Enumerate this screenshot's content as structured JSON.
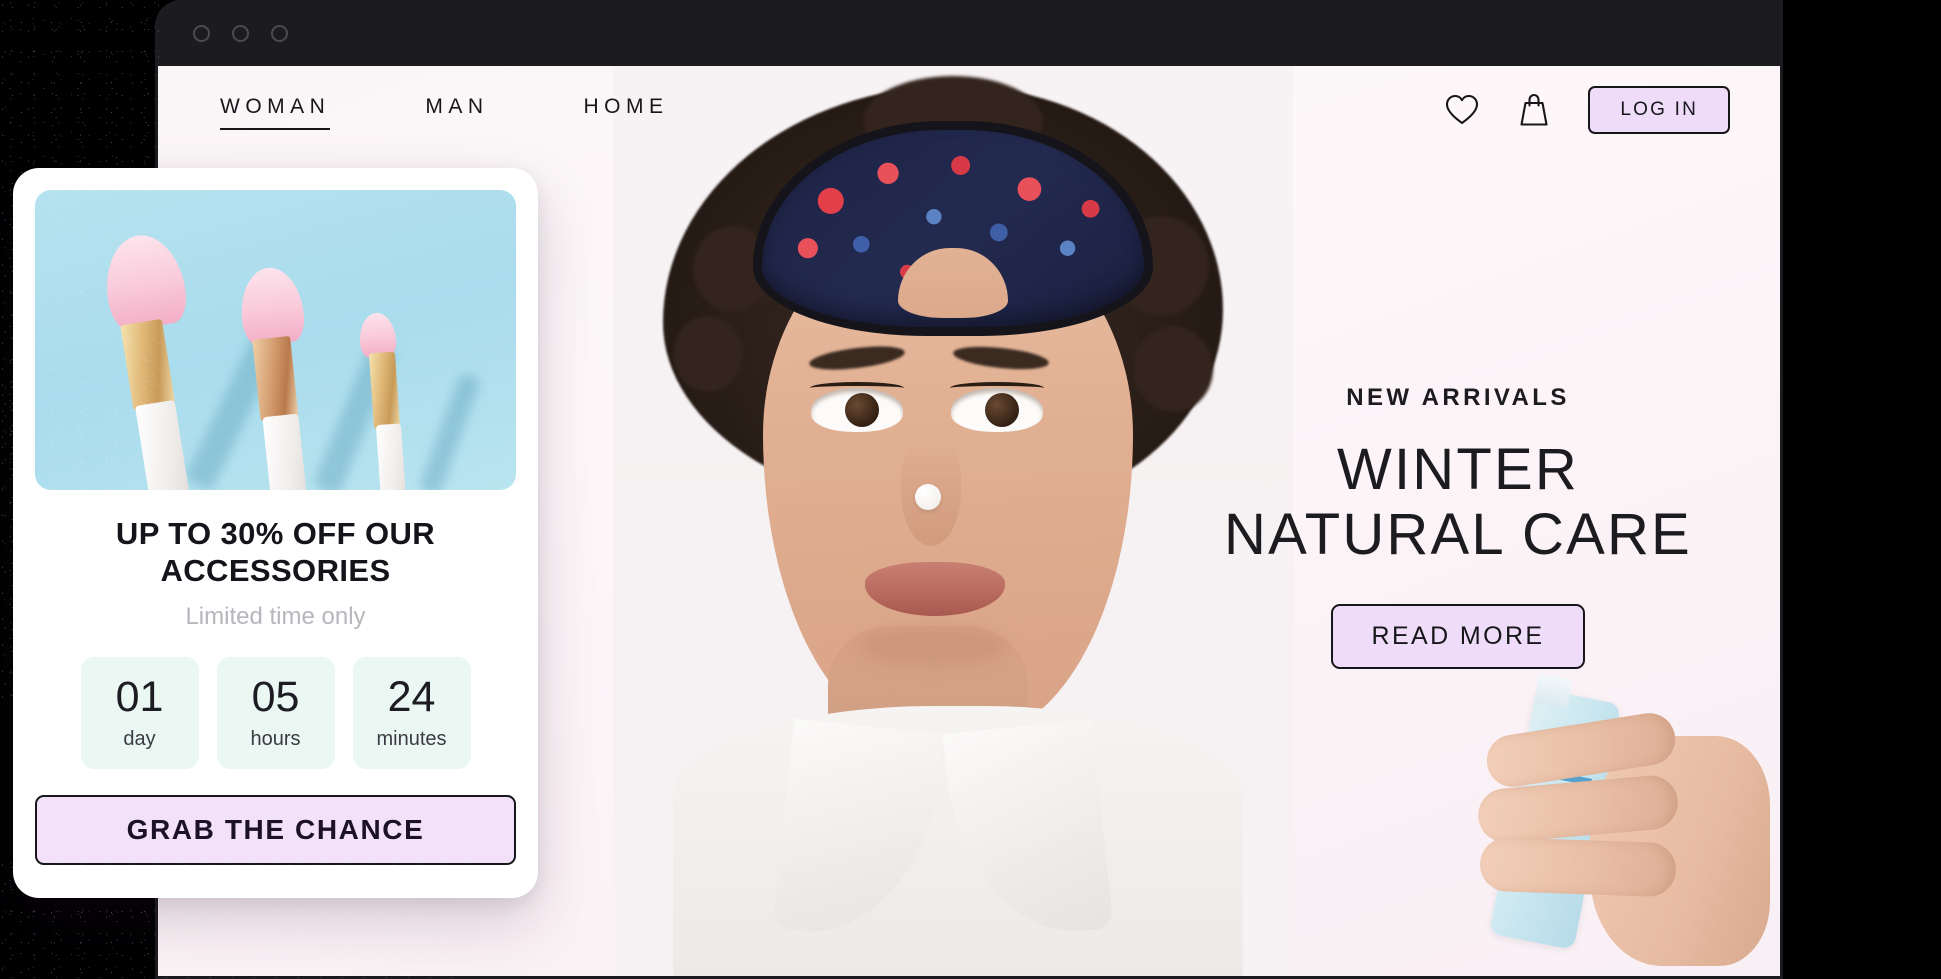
{
  "browser": {
    "traffic_lights": [
      "window-dot-1",
      "window-dot-2",
      "window-dot-3"
    ]
  },
  "site_nav": {
    "links": [
      {
        "label": "WOMAN",
        "active": true
      },
      {
        "label": "MAN",
        "active": false
      },
      {
        "label": "HOME",
        "active": false
      }
    ],
    "icons": [
      {
        "name": "heart-icon",
        "title": "Wishlist"
      },
      {
        "name": "shopping-bag-icon",
        "title": "Cart"
      }
    ],
    "login_label": "LOG IN"
  },
  "hero": {
    "eyebrow": "NEW ARRIVALS",
    "title": "WINTER\nNATURAL CARE",
    "cta_label": "READ MORE",
    "image_alt": "Woman wearing a berry-print sleep mask with a cream dot on her nose",
    "product_alt": "Hand holding a light blue skincare spray bottle"
  },
  "promo_card": {
    "image_alt": "Three makeup brushes with pink bristles on a light blue background",
    "headline": "UP TO 30% OFF OUR ACCESSORIES",
    "subtitle": "Limited time only",
    "countdown": [
      {
        "value": "01",
        "label": "day"
      },
      {
        "value": "05",
        "label": "hours"
      },
      {
        "value": "24",
        "label": "minutes"
      }
    ],
    "cta_label": "GRAB THE CHANCE"
  },
  "colors": {
    "accent_lavender": "#eedcf8",
    "cta_lavender": "#f2e1f9",
    "ink": "#17171b",
    "countdown_bg": "#eaf7f2",
    "page_bg": "#faf5f7",
    "brush_bg": "#b6e2ef",
    "chrome_dark": "#1c1c20",
    "muted_text": "#b6b6bd"
  }
}
